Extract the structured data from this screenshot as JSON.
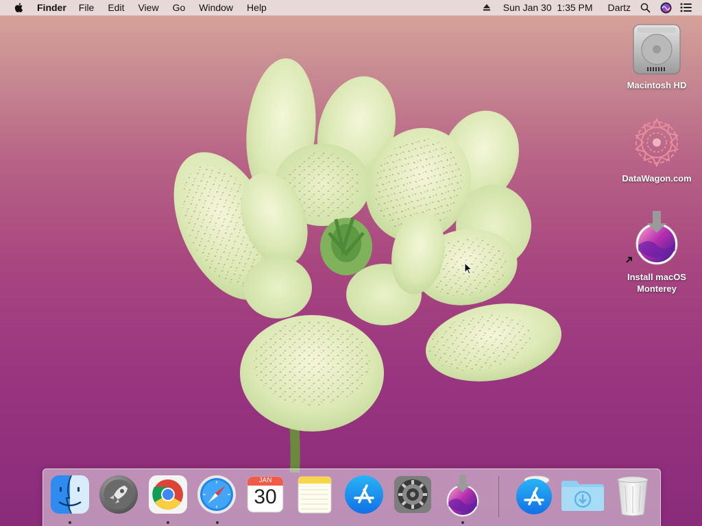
{
  "menubar": {
    "app_name": "Finder",
    "menus": [
      "File",
      "Edit",
      "View",
      "Go",
      "Window",
      "Help"
    ],
    "status": {
      "datetime": "Sun Jan 30  1:35 PM",
      "user": "Dartz",
      "icons": [
        "eject-icon",
        "spotlight-search-icon",
        "siri-icon",
        "control-center-icon"
      ]
    }
  },
  "desktop": {
    "icons": [
      {
        "label": "Macintosh HD",
        "icon": "hard-drive-icon"
      },
      {
        "label": "DataWagon.com",
        "icon": "server-alias-icon"
      },
      {
        "label_line1": "Install macOS",
        "label_line2": "Monterey",
        "icon": "monterey-installer-icon"
      }
    ]
  },
  "dock": {
    "apps": [
      {
        "name": "Finder",
        "icon": "finder-icon",
        "running": true
      },
      {
        "name": "Launchpad",
        "icon": "launchpad-icon",
        "running": false
      },
      {
        "name": "Google Chrome",
        "icon": "chrome-icon",
        "running": true
      },
      {
        "name": "Safari",
        "icon": "safari-icon",
        "running": true
      },
      {
        "name": "Calendar",
        "icon": "calendar-icon",
        "running": false,
        "month": "JAN",
        "day": "30"
      },
      {
        "name": "Notes",
        "icon": "notes-icon",
        "running": false
      },
      {
        "name": "App Store",
        "icon": "app-store-icon",
        "running": false
      },
      {
        "name": "System Preferences",
        "icon": "system-preferences-icon",
        "running": false
      },
      {
        "name": "Install macOS Monterey",
        "icon": "monterey-installer-icon",
        "running": true
      }
    ],
    "others": [
      {
        "name": "App Store Downloads",
        "icon": "app-store-icon"
      },
      {
        "name": "Downloads",
        "icon": "downloads-folder-icon"
      },
      {
        "name": "Trash",
        "icon": "trash-icon"
      }
    ]
  },
  "colors": {
    "wallpaper_top": "#d9a79b",
    "wallpaper_bottom": "#8a2c7a",
    "menubar_bg": "#ebe4e6"
  }
}
